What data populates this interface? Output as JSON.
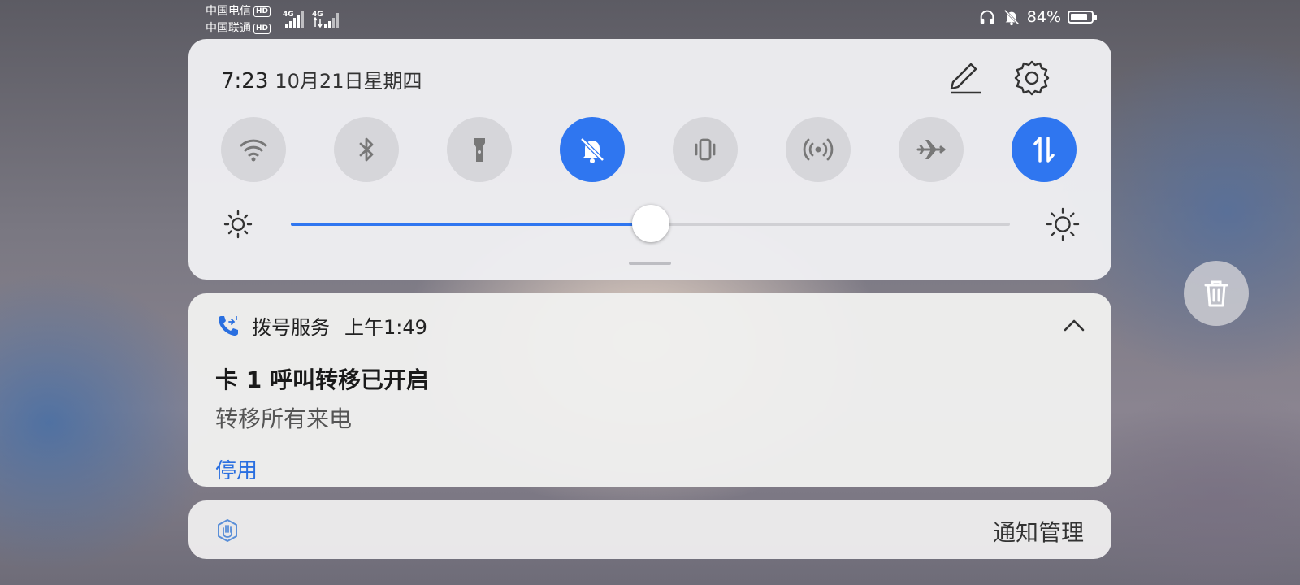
{
  "status_bar": {
    "carrier_1": "中国电信",
    "carrier_2": "中国联通",
    "hd_badge": "HD",
    "network_type_1": "4G",
    "network_type_2": "4G",
    "battery_text": "84%",
    "battery_level": 0.84,
    "icons": [
      "headphones-icon",
      "bell-off-icon",
      "battery-charging-icon"
    ]
  },
  "control_panel": {
    "time": "7:23",
    "date": "10月21日星期四",
    "edit_icon": "pencil-icon",
    "settings_icon": "gear-icon",
    "toggles": [
      {
        "icon": "wifi-icon",
        "on": false
      },
      {
        "icon": "bluetooth-icon",
        "on": false
      },
      {
        "icon": "flashlight-icon",
        "on": false
      },
      {
        "icon": "bell-off-icon",
        "on": true
      },
      {
        "icon": "vibrate-icon",
        "on": false
      },
      {
        "icon": "hotspot-icon",
        "on": false
      },
      {
        "icon": "airplane-icon",
        "on": false
      },
      {
        "icon": "mobile-data-icon",
        "on": true
      }
    ],
    "brightness_level": 0.5,
    "active_color": "#2f76f0"
  },
  "notification": {
    "app_name": "拨号服务",
    "time": "上午1:49",
    "title": "卡 1 呼叫转移已开启",
    "body": "转移所有来电",
    "action": "停用",
    "action_color": "#2a6fe0"
  },
  "manage_bar": {
    "label": "通知管理"
  }
}
